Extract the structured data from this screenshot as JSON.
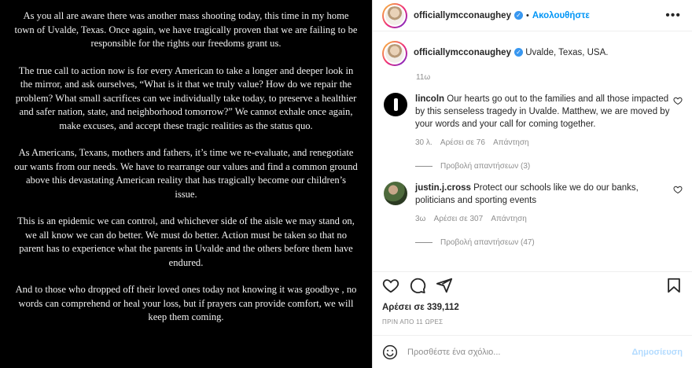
{
  "image_text": {
    "paragraphs": [
      "As you all are aware there was another mass shooting today, this time in my home town of Uvalde, Texas. Once again, we have tragically proven that we are failing to be responsible for the rights our freedoms grant us.",
      "The true call to action now is for every American to take a longer and deeper look in the mirror, and ask ourselves, “What is it that we truly value? How do we repair the problem? What small sacrifices can we individually take today, to preserve a healthier and safer nation, state, and neighborhood tomorrow?” We cannot exhale once again, make excuses, and accept these tragic realities as the status quo.",
      "As Americans, Texans, mothers and fathers, it’s time we re-evaluate, and renegotiate our wants from our needs. We have to rearrange our values and find a common ground above this devastating American reality that has tragically become our children’s issue.",
      "This is an epidemic we can control, and whichever side of the aisle we may stand on, we all know we can do better. We must do better.  Action must be taken so that no parent has to experience what the parents in Uvalde and the others before them have endured.",
      "And to those who dropped off their loved ones today not knowing it was goodbye , no words can comprehend or heal your loss, but if prayers can provide comfort, we will keep them coming."
    ]
  },
  "header": {
    "username": "officiallymcconaughey",
    "separator": "•",
    "follow_label": "Ακολουθήστε",
    "more_label": "•••"
  },
  "caption": {
    "username": "officiallymcconaughey",
    "location": "Uvalde, Texas, USA.",
    "age": "11ω"
  },
  "comments": [
    {
      "username": "lincoln",
      "text": "Our hearts go out to the families and all those impacted by this senseless tragedy in Uvalde. Matthew, we are moved by your words and your call for coming together.",
      "age": "30 λ.",
      "likes": "Αρέσει σε 76",
      "reply_label": "Απάντηση",
      "view_replies": "Προβολή απαντήσεων (3)"
    },
    {
      "username": "justin.j.cross",
      "text": "Protect our schools like we do our banks, politicians and sporting events",
      "age": "3ω",
      "likes": "Αρέσει σε 307",
      "reply_label": "Απάντηση",
      "view_replies": "Προβολή απαντήσεων (47)"
    }
  ],
  "post_meta": {
    "likes": "Αρέσει σε 339,112",
    "time": "ΠΡΙΝ ΑΠΟ 11 ΩΡΕΣ"
  },
  "comment_box": {
    "placeholder": "Προσθέστε ένα σχόλιο...",
    "post_label": "Δημοσίευση"
  },
  "colors": {
    "accent": "#0095f6",
    "post_disabled": "#b3dbff",
    "muted": "#8e8e8e"
  }
}
